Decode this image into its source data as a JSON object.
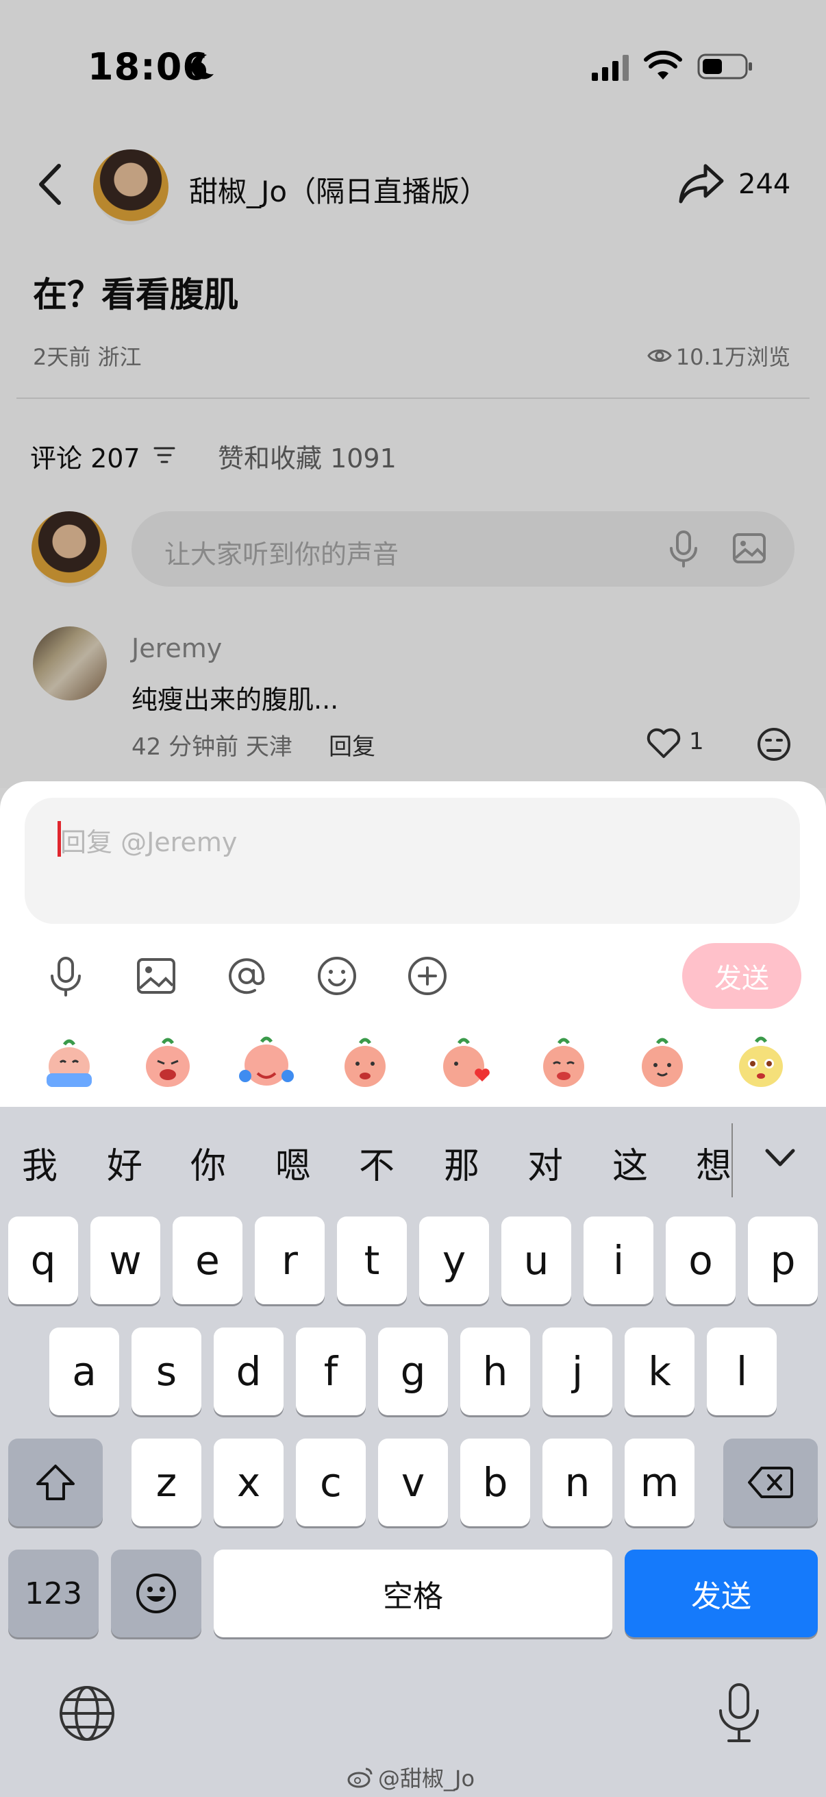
{
  "status_bar": {
    "time": "18:06"
  },
  "header": {
    "author_name": "甜椒_Jo（隔日直播版）",
    "share_count": "244"
  },
  "post": {
    "title": "在？看看腹肌",
    "meta": "2天前 浙江",
    "views": "10.1万浏览"
  },
  "tabs": {
    "comments": "评论 207",
    "likes": "赞和收藏 1091"
  },
  "comment_input": {
    "placeholder": "让大家听到你的声音"
  },
  "comment": {
    "username": "Jeremy",
    "text": "纯瘦出来的腹肌...",
    "meta": "42 分钟前 天津",
    "reply": "回复",
    "likes": "1"
  },
  "reply_sheet": {
    "placeholder": "回复 @Jeremy",
    "send": "发送"
  },
  "keyboard": {
    "candidates": [
      "我",
      "好",
      "你",
      "嗯",
      "不",
      "那",
      "对",
      "这",
      "想"
    ],
    "row1": [
      "q",
      "w",
      "e",
      "r",
      "t",
      "y",
      "u",
      "i",
      "o",
      "p"
    ],
    "row2": [
      "a",
      "s",
      "d",
      "f",
      "g",
      "h",
      "j",
      "k",
      "l"
    ],
    "row3": [
      "z",
      "x",
      "c",
      "v",
      "b",
      "n",
      "m"
    ],
    "numbers": "123",
    "space": "空格",
    "send": "发送"
  },
  "watermark": "@甜椒_Jo"
}
